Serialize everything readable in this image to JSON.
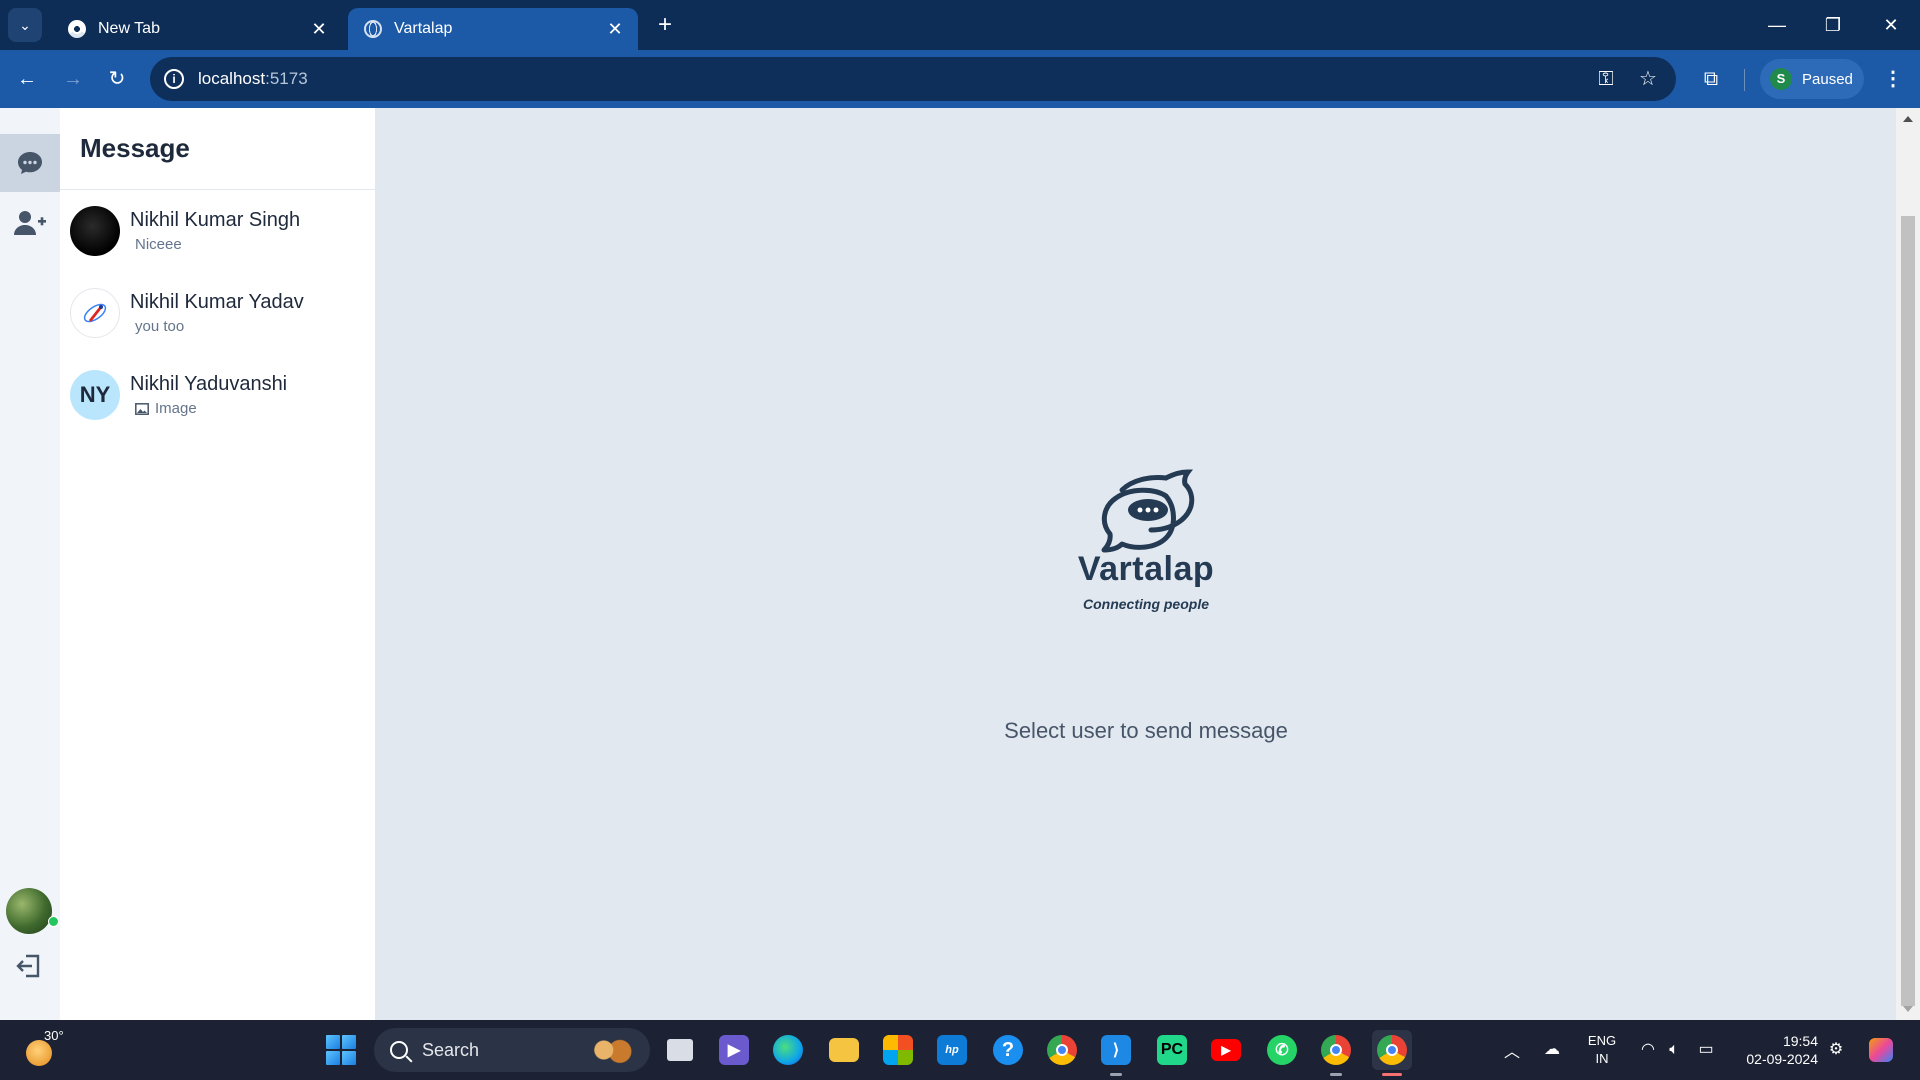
{
  "browser": {
    "tabs": [
      {
        "title": "New Tab",
        "active": false
      },
      {
        "title": "Vartalap",
        "active": true
      }
    ],
    "url_host": "localhost",
    "url_port": ":5173",
    "profile_initial": "S",
    "profile_status": "Paused"
  },
  "app": {
    "sidebar_title": "Message",
    "conversations": [
      {
        "name": "Nikhil Kumar Singh",
        "last_message": "Niceee",
        "avatar": "photo-dark"
      },
      {
        "name": "Nikhil Kumar Yadav",
        "last_message": "you too",
        "avatar": "rocket-logo"
      },
      {
        "name": "Nikhil Yaduvanshi",
        "last_message": "Image",
        "avatar_initials": "NY",
        "message_icon": "image-icon"
      }
    ],
    "brand_name": "Vartalap",
    "tagline": "Connecting people",
    "empty_state": "Select user to send message"
  },
  "taskbar": {
    "temperature": "30°",
    "search_placeholder": "Search",
    "language_line1": "ENG",
    "language_line2": "IN",
    "time": "19:54",
    "date": "02-09-2024"
  },
  "colors": {
    "tab_strip": "#0d2d57",
    "toolbar": "#1c5aa8",
    "main_bg": "#e2e8f0",
    "brand_text": "#243b53",
    "online": "#22c55e"
  }
}
